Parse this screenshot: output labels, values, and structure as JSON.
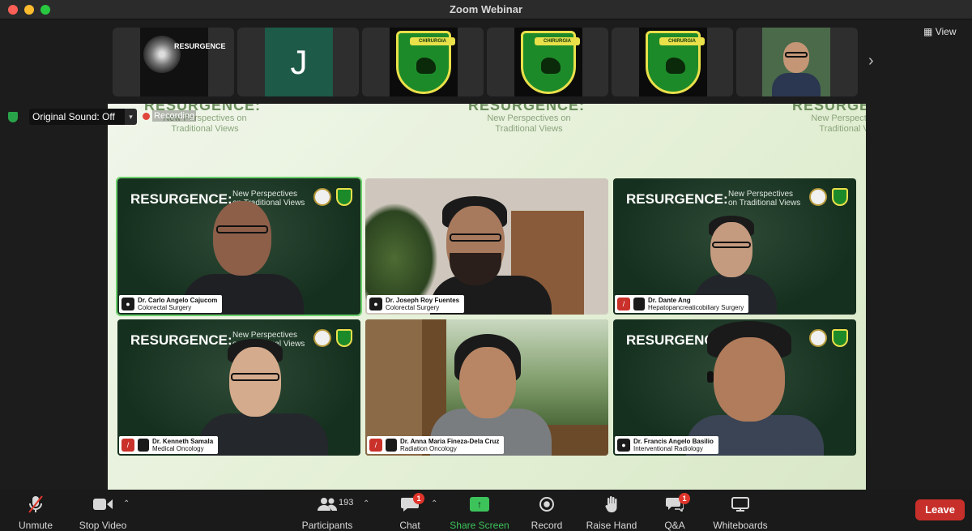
{
  "window": {
    "title": "Zoom Webinar"
  },
  "view_button": {
    "label": "View",
    "icon": "grid-icon"
  },
  "strip": {
    "next_icon": "chevron-right-icon",
    "thumbs": [
      {
        "type": "slide",
        "text": "RESURGENCE"
      },
      {
        "type": "initial",
        "text": "J"
      },
      {
        "type": "crest",
        "text": "CHIRURGIA"
      },
      {
        "type": "crest",
        "text": "CHIRURGIA"
      },
      {
        "type": "crest",
        "text": "CHIRURGIA"
      },
      {
        "type": "person"
      }
    ]
  },
  "stage": {
    "bg_title": "RESURGENCE:",
    "bg_subtitle_1": "New Perspectives on",
    "bg_subtitle_2": "Traditional Views",
    "sound_label": "Original Sound: Off",
    "recording_label": "Recording"
  },
  "tiles": [
    {
      "name": "Dr. Carlo Angelo Cajucom",
      "role": "Colorectal Surgery",
      "slide_title": "RESURGENCE:",
      "slide_sub_1": "New Perspectives",
      "slide_sub_2": "on Traditional Views",
      "active": true
    },
    {
      "name": "Dr. Joseph Roy Fuentes",
      "role": "Colorectal Surgery",
      "slide_title": "",
      "slide_sub_1": "",
      "slide_sub_2": ""
    },
    {
      "name": "Dr. Dante Ang",
      "role": "Hepatopancreaticobiliary Surgery",
      "slide_title": "RESURGENCE:",
      "slide_sub_1": "New Perspectives",
      "slide_sub_2": "on Traditional Views"
    },
    {
      "name": "Dr. Kenneth Samala",
      "role": "Medical Oncology",
      "slide_title": "RESURGENCE:",
      "slide_sub_1": "New Perspectives",
      "slide_sub_2": "on Traditional Views"
    },
    {
      "name": "Dr. Anna Maria Fineza-Dela Cruz",
      "role": "Radiation Oncology",
      "slide_title": "",
      "slide_sub_1": "",
      "slide_sub_2": ""
    },
    {
      "name": "Dr. Francis Angelo Basilio",
      "role": "Interventional Radiology",
      "slide_title": "RESURGENCE",
      "slide_sub_1": "",
      "slide_sub_2": ""
    }
  ],
  "toolbar": {
    "unmute": "Unmute",
    "stop_video": "Stop Video",
    "participants": "Participants",
    "participants_count": "193",
    "chat": "Chat",
    "chat_badge": "1",
    "share_screen": "Share Screen",
    "record": "Record",
    "raise_hand": "Raise Hand",
    "qa": "Q&A",
    "qa_badge": "1",
    "whiteboards": "Whiteboards",
    "leave": "Leave"
  },
  "colors": {
    "accent_green": "#3cc35a",
    "leave_red": "#c72f2a",
    "badge_red": "#e0352b",
    "active_outline": "#6bcf6b"
  }
}
